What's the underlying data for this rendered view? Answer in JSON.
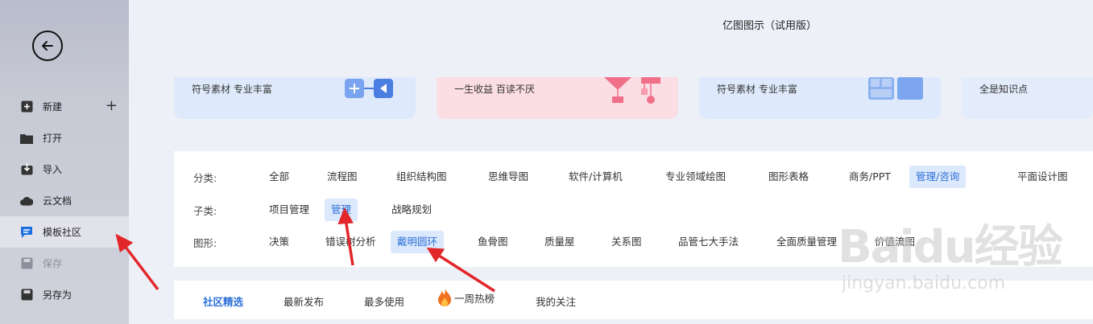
{
  "app_title": "亿图图示（试用版）",
  "sidebar": {
    "back_icon": "arrow-left-icon",
    "items": [
      {
        "label": "新建",
        "icon": "plus-square-icon"
      },
      {
        "label": "打开",
        "icon": "folder-icon"
      },
      {
        "label": "导入",
        "icon": "import-icon"
      },
      {
        "label": "云文档",
        "icon": "cloud-icon"
      },
      {
        "label": "模板社区",
        "icon": "chat-icon"
      },
      {
        "label": "保存",
        "icon": "save-icon"
      },
      {
        "label": "另存为",
        "icon": "save-as-icon"
      }
    ],
    "new_plus": "+"
  },
  "banners": [
    {
      "text": "符号素材 专业丰富"
    },
    {
      "text": "一生收益 百读不厌"
    },
    {
      "text": "符号素材 专业丰富"
    },
    {
      "text": "全是知识点"
    }
  ],
  "filters": {
    "category_label": "分类:",
    "categories": [
      "全部",
      "流程图",
      "组织结构图",
      "思维导图",
      "软件/计算机",
      "专业领域绘图",
      "图形表格",
      "商务/PPT",
      "管理/咨询",
      "平面设计图"
    ],
    "subcategory_label": "子类:",
    "subcategories": [
      "项目管理",
      "管理",
      "战略规划"
    ],
    "shape_label": "图形:",
    "shapes": [
      "决策",
      "错误树分析",
      "戴明圆环",
      "鱼骨图",
      "质量屋",
      "关系图",
      "品管七大手法",
      "全面质量管理",
      "价值流图"
    ]
  },
  "tabs": [
    "社区精选",
    "最新发布",
    "最多使用",
    "一周热榜",
    "我的关注"
  ],
  "watermark": {
    "logo": "Baidu经验",
    "url": "jingyan.baidu.com"
  },
  "colors": {
    "accent": "#2b6fd8",
    "selected_bg": "#dce8fb",
    "arrow": "#e3262a"
  }
}
